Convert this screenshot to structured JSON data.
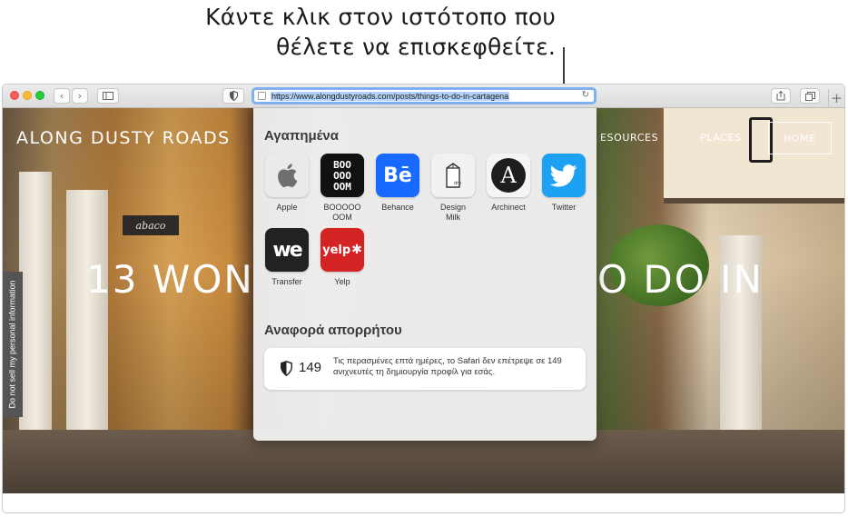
{
  "callout": {
    "line1": "Κάντε κλικ στον ιστότοπο που",
    "line2": "θέλετε να επισκεφθείτε."
  },
  "toolbar": {
    "url": "https://www.alongdustyroads.com/posts/things-to-do-in-cartagena",
    "new_tab": "+"
  },
  "page": {
    "logo": "ALONG DUSTY ROADS",
    "nav_resources": "ESOURCES",
    "nav_places": "PLACES",
    "nav_home": "HOME",
    "hero_left": "13 WON",
    "hero_right": "O DO IN",
    "sign": "abaco",
    "cookie_notice": "Do not sell my personal information"
  },
  "popover": {
    "favorites_title": "Αγαπημένα",
    "favorites": [
      {
        "label": "Apple",
        "icon": "apple-logo-icon"
      },
      {
        "label": "BOOOOO\nOOM",
        "icon": "boooooom-logo-icon",
        "tile_text": "BOO\nOOO\nOOM"
      },
      {
        "label": "Behance",
        "icon": "behance-logo-icon",
        "tile_text": "Bē"
      },
      {
        "label": "Design\nMilk",
        "icon": "design-milk-logo-icon"
      },
      {
        "label": "Archinect",
        "icon": "archinect-logo-icon",
        "tile_text": "A"
      },
      {
        "label": "Twitter",
        "icon": "twitter-bird-icon"
      },
      {
        "label": "Transfer",
        "icon": "wetransfer-logo-icon",
        "tile_text": "we"
      },
      {
        "label": "Yelp",
        "icon": "yelp-logo-icon",
        "tile_text": "yelp"
      }
    ],
    "privacy_title": "Αναφορά απορρήτου",
    "trackers_count": "149",
    "privacy_text": "Τις περασμένες επτά ημέρες, το Safari δεν επέτρεψε σε 149 ανιχνευτές τη δημιουργία προφίλ για εσάς."
  },
  "colors": {
    "accent": "#7fb0f0",
    "twitter": "#1da1f2",
    "behance": "#1769ff",
    "yelp": "#d32323"
  }
}
